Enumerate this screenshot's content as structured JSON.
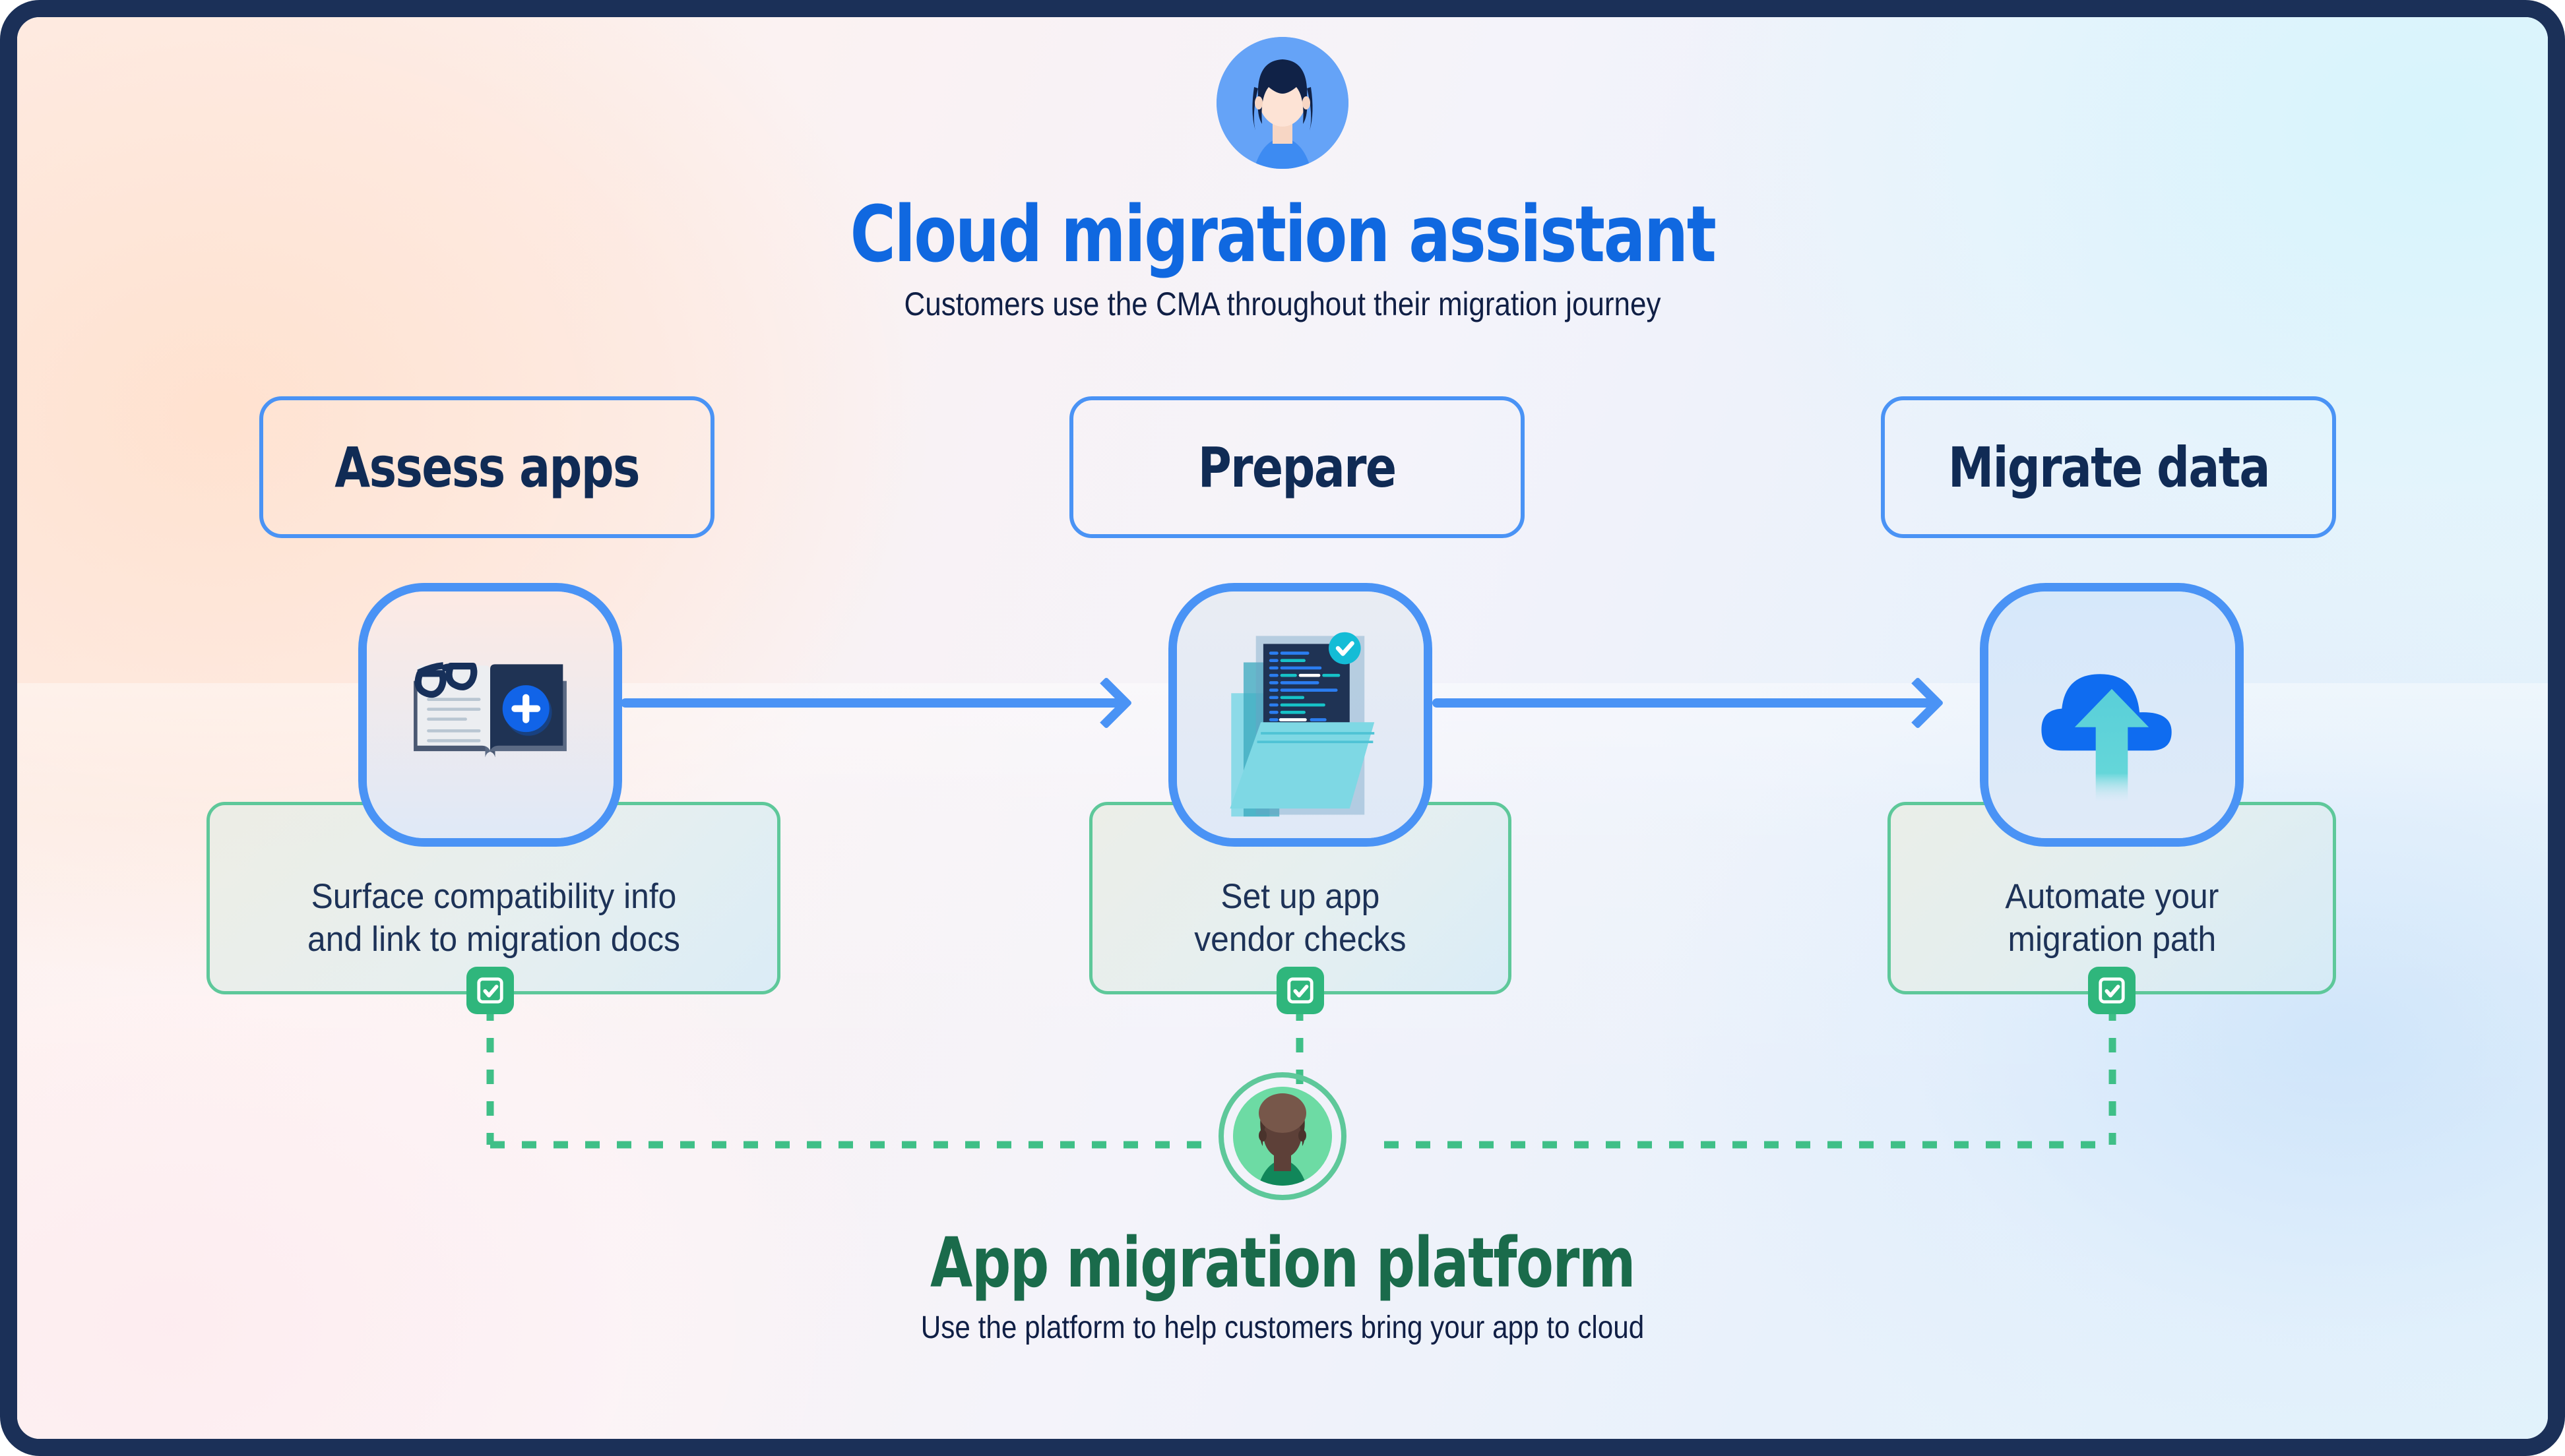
{
  "header": {
    "avatar": "woman-avatar-icon",
    "title": "Cloud migration assistant",
    "subtitle": "Customers use the CMA throughout their migration journey"
  },
  "footer": {
    "avatar": "person-avatar-icon",
    "title": "App migration platform",
    "subtitle": "Use the platform to help customers bring your app to cloud"
  },
  "stages": [
    {
      "label": "Assess apps",
      "icon": "book-glasses-plus-icon",
      "outcome": "Surface compatibility info\nand link to migration docs",
      "outcome_line1": "Surface compatibility info",
      "outcome_line2": "and link to migration docs",
      "badge": "checkbox-icon"
    },
    {
      "label": "Prepare",
      "icon": "folder-document-check-icon",
      "outcome": "Set up app\nvendor checks",
      "outcome_line1": "Set up app",
      "outcome_line2": "vendor checks",
      "badge": "checkbox-icon"
    },
    {
      "label": "Migrate data",
      "icon": "cloud-upload-icon",
      "outcome": "Automate your\nmigration path",
      "outcome_line1": "Automate your",
      "outcome_line2": "migration path",
      "badge": "checkbox-icon"
    }
  ],
  "connectors": {
    "arrow": "right-arrow-icon",
    "arrow_count": 2,
    "dashed_line": "dashed-connector"
  },
  "colors": {
    "title_blue": "#1068e0",
    "title_green": "#1a6b4b",
    "text_navy": "#1d3257",
    "border_blue": "#4a93f5",
    "border_green": "#5ec89a",
    "badge_green": "#2fb67c",
    "frame_navy": "#1b3058"
  }
}
